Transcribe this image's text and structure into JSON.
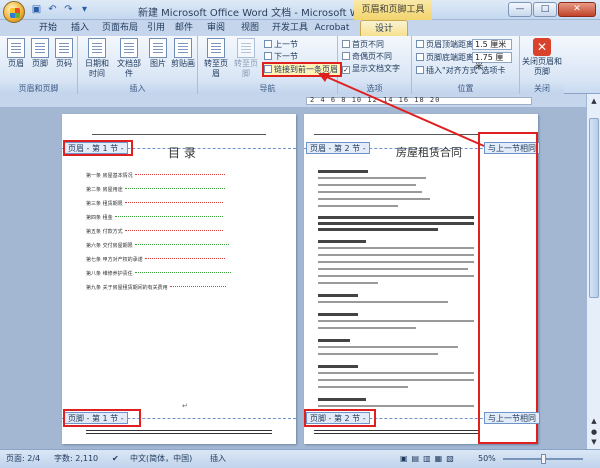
{
  "window": {
    "title": "新建 Microsoft Office Word 文档 - Microsoft Word",
    "context_group": "页眉和页脚工具",
    "controls": [
      "—",
      "□",
      "✕"
    ]
  },
  "quick_access": [
    "save-icon",
    "undo-icon",
    "redo-icon",
    "customize-icon"
  ],
  "tabs": [
    "开始",
    "插入",
    "页面布局",
    "引用",
    "邮件",
    "审阅",
    "视图",
    "开发工具",
    "Acrobat",
    "设计"
  ],
  "ribbon": {
    "hf_group": {
      "label": "页眉和页脚",
      "buttons": [
        "页眉",
        "页脚",
        "页码"
      ]
    },
    "insert_group": {
      "label": "插入",
      "buttons": [
        "日期和时间",
        "文档部件",
        "图片",
        "剪贴画"
      ]
    },
    "nav_group": {
      "label": "导航",
      "goto_header": "转至页眉",
      "goto_footer": "转至页脚",
      "prev": "上一节",
      "next": "下一节",
      "link_prev": "链接到前一条页眉"
    },
    "options_group": {
      "label": "选项",
      "first_page": "首页不同",
      "odd_even": "奇偶页不同",
      "show_text": "显示文档文字"
    },
    "position_group": {
      "label": "位置",
      "header_top": "页眉顶端距离:",
      "header_top_value": "1.5 厘米",
      "footer_bottom": "页脚底端距离:",
      "footer_bottom_value": "1.75 厘米",
      "insert_align": "插入\"对齐方式\"选项卡"
    },
    "close_group": {
      "label": "关闭",
      "close": "关闭页眉和页脚"
    }
  },
  "ruler": {
    "numbers": "2  4  6  8  10  12  14  16  18  20"
  },
  "pages": {
    "left": {
      "header_tag": "页眉 - 第 1 节 -",
      "footer_tag": "页脚 - 第 1 节 -",
      "title": "目 录",
      "toc": [
        "第一条  房屋基本情况",
        "第二条  房屋用途",
        "第三条  租赁期限",
        "第四条  租金",
        "第五条  付款方式",
        "第六条  交付房屋期限",
        "第七条  甲方对产权的承诺",
        "第八条  维修养护责任",
        "第九条  关于房屋租赁期间的有关费用"
      ]
    },
    "right": {
      "header_tag": "页眉 - 第 2 节 -",
      "footer_tag": "页脚 - 第 2 节 -",
      "same_as_prev_header": "与上一节相同",
      "same_as_prev_footer": "与上一节相同",
      "title": "房屋租赁合同"
    }
  },
  "statusbar": {
    "page": "页面: 2/4",
    "words": "字数: 2,110",
    "lang": "中文(简体，中国)",
    "mode": "插入",
    "zoom": "50%"
  }
}
